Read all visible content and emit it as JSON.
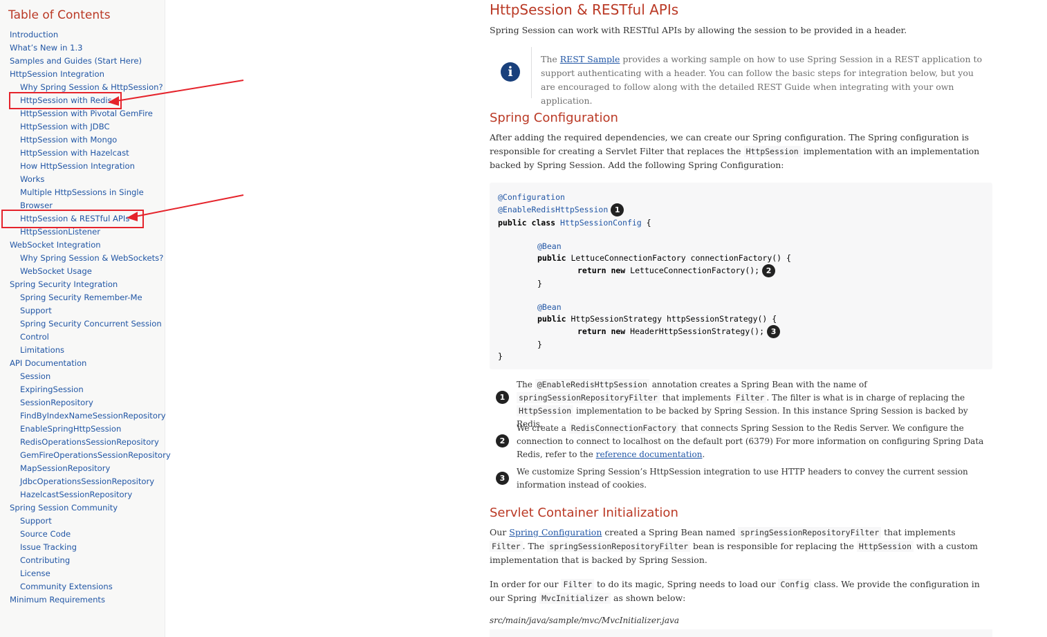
{
  "toc": {
    "title": "Table of Contents",
    "items": [
      {
        "label": "Introduction",
        "level": 0
      },
      {
        "label": "What’s New in 1.3",
        "level": 0
      },
      {
        "label": "Samples and Guides (Start Here)",
        "level": 0
      },
      {
        "label": "HttpSession Integration",
        "level": 0
      },
      {
        "label": "Why Spring Session & HttpSession?",
        "level": 1
      },
      {
        "label": "HttpSession with Redis",
        "level": 1
      },
      {
        "label": "HttpSession with Pivotal GemFire",
        "level": 1
      },
      {
        "label": "HttpSession with JDBC",
        "level": 1
      },
      {
        "label": "HttpSession with Mongo",
        "level": 1
      },
      {
        "label": "HttpSession with Hazelcast",
        "level": 1
      },
      {
        "label": "How HttpSession Integration",
        "level": 1
      },
      {
        "label": "Works",
        "level": 1
      },
      {
        "label": "Multiple HttpSessions in Single",
        "level": 1
      },
      {
        "label": "Browser",
        "level": 1
      },
      {
        "label": "HttpSession & RESTful APIs",
        "level": 1
      },
      {
        "label": "HttpSessionListener",
        "level": 1
      },
      {
        "label": "WebSocket Integration",
        "level": 0
      },
      {
        "label": "Why Spring Session & WebSockets?",
        "level": 1
      },
      {
        "label": "WebSocket Usage",
        "level": 1
      },
      {
        "label": "Spring Security Integration",
        "level": 0
      },
      {
        "label": "Spring Security Remember-Me",
        "level": 1
      },
      {
        "label": "Support",
        "level": 1
      },
      {
        "label": "Spring Security Concurrent Session",
        "level": 1
      },
      {
        "label": "Control",
        "level": 1
      },
      {
        "label": "Limitations",
        "level": 1
      },
      {
        "label": "API Documentation",
        "level": 0
      },
      {
        "label": "Session",
        "level": 1
      },
      {
        "label": "ExpiringSession",
        "level": 1
      },
      {
        "label": "SessionRepository",
        "level": 1
      },
      {
        "label": "FindByIndexNameSessionRepository",
        "level": 1
      },
      {
        "label": "EnableSpringHttpSession",
        "level": 1
      },
      {
        "label": "RedisOperationsSessionRepository",
        "level": 1
      },
      {
        "label": "GemFireOperationsSessionRepository",
        "level": 1
      },
      {
        "label": "MapSessionRepository",
        "level": 1
      },
      {
        "label": "JdbcOperationsSessionRepository",
        "level": 1
      },
      {
        "label": "HazelcastSessionRepository",
        "level": 1
      },
      {
        "label": "Spring Session Community",
        "level": 0
      },
      {
        "label": "Support",
        "level": 1
      },
      {
        "label": "Source Code",
        "level": 1
      },
      {
        "label": "Issue Tracking",
        "level": 1
      },
      {
        "label": "Contributing",
        "level": 1
      },
      {
        "label": "License",
        "level": 1
      },
      {
        "label": "Community Extensions",
        "level": 1
      },
      {
        "label": "Minimum Requirements",
        "level": 0
      }
    ]
  },
  "content": {
    "heading": "HttpSession & RESTful APIs",
    "intro": "Spring Session can work with RESTful APIs by allowing the session to be provided in a header.",
    "note": {
      "icon": "info-icon",
      "pre": "The ",
      "link": "REST Sample",
      "post": " provides a working sample on how to use Spring Session in a REST application to support authenticating with a header. You can follow the basic steps for integration below, but you are encouraged to follow along with the detailed REST Guide when integrating with your own application."
    },
    "spring_config": {
      "heading": "Spring Configuration",
      "p1": "After adding the required dependencies, we can create our Spring configuration. The Spring configuration is responsible for creating a Servlet Filter that replaces the ",
      "p1_code": "HttpSession",
      "p1_post": " implementation with an implementation backed by Spring Session. Add the following Spring Configuration:"
    },
    "code": {
      "l1": "@Configuration",
      "l2": "@EnableRedisHttpSession",
      "l3a": "public class ",
      "l3b": "HttpSessionConfig",
      "l3c": " {",
      "l4": "@Bean",
      "l5a": "public ",
      "l5b": "LettuceConnectionFactory connectionFactory() {",
      "l6a": "return new ",
      "l6b": "LettuceConnectionFactory();",
      "l7": "}",
      "l8": "@Bean",
      "l9a": "public ",
      "l9b": "HttpSessionStrategy httpSessionStrategy() {",
      "l10a": "return new ",
      "l10b": "HeaderHttpSessionStrategy();",
      "l11": "}",
      "l12": "}",
      "b1": "1",
      "b2": "2",
      "b3": "3"
    },
    "callouts": {
      "c1": {
        "n": "1",
        "t1": "The ",
        "c1": "@EnableRedisHttpSession",
        "t2": " annotation creates a Spring Bean with the name of ",
        "c2": "springSessionRepositoryFilter",
        "t3": " that implements ",
        "c3": "Filter",
        "t4": ". The filter is what is in charge of replacing the ",
        "c4": "HttpSession",
        "t5": " implementation to be backed by Spring Session. In this instance Spring Session is backed by Redis."
      },
      "c2": {
        "n": "2",
        "t1": "We create a ",
        "c1": "RedisConnectionFactory",
        "t2": " that connects Spring Session to the Redis Server. We configure the connection to connect to localhost on the default port (6379) For more information on configuring Spring Data Redis, refer to the ",
        "link": "reference documentation",
        "t3": "."
      },
      "c3": {
        "n": "3",
        "t1": "We customize Spring Session’s HttpSession integration to use HTTP headers to convey the current session information instead of cookies."
      }
    },
    "servlet": {
      "heading": "Servlet Container Initialization",
      "p1a": "Our ",
      "p1_link": "Spring Configuration",
      "p1b": " created a Spring Bean named ",
      "p1_c1": "springSessionRepositoryFilter",
      "p1c": " that implements ",
      "p1_c2": "Filter",
      "p1d": ". The ",
      "p1_c3": "springSessionRepositoryFilter",
      "p1e": " bean is responsible for replacing the ",
      "p1_c4": "HttpSession",
      "p1f": " with a custom implementation that is backed by Spring Session.",
      "p2a": "In order for our ",
      "p2_c1": "Filter",
      "p2b": " to do its magic, Spring needs to load our ",
      "p2_c2": "Config",
      "p2c": " class. We provide the configuration in our Spring ",
      "p2_c3": "MvcInitializer",
      "p2d": " as shown below:",
      "caption": "src/main/java/sample/mvc/MvcInitializer.java"
    }
  },
  "annotation": {
    "color": "#e5232b"
  }
}
